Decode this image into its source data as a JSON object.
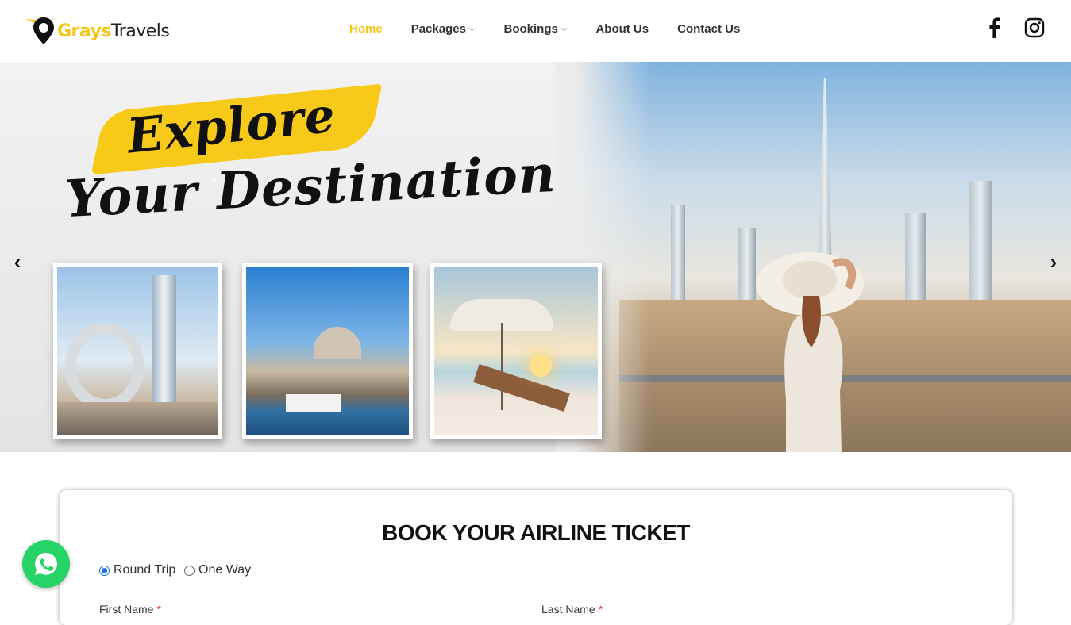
{
  "brand": {
    "part1": "Grays",
    "part2": "Travels",
    "accent_color": "#f5c518"
  },
  "nav": {
    "items": [
      {
        "label": "Home",
        "active": true,
        "dropdown": false
      },
      {
        "label": "Packages",
        "active": false,
        "dropdown": true
      },
      {
        "label": "Bookings",
        "active": false,
        "dropdown": true
      },
      {
        "label": "About Us",
        "active": false,
        "dropdown": false
      },
      {
        "label": "Contact Us",
        "active": false,
        "dropdown": false
      }
    ],
    "chevron": "⌵"
  },
  "social": {
    "icons": [
      "facebook-icon",
      "instagram-icon"
    ]
  },
  "hero": {
    "headline_line1": "Explore",
    "headline_line2": "Your Destination",
    "prev_arrow": "‹",
    "next_arrow": "›",
    "cards": [
      "museum-of-the-future-dubai",
      "istanbul-mosque-bosphorus",
      "beach-loungers-umbrella"
    ]
  },
  "booking": {
    "title": "BOOK YOUR AIRLINE TICKET",
    "trip_options": [
      {
        "label": "Round Trip",
        "selected": true
      },
      {
        "label": "One Way",
        "selected": false
      }
    ],
    "first_name_label": "First Name",
    "last_name_label": "Last Name",
    "required_mark": "*"
  },
  "whatsapp": {
    "icon": "whatsapp-icon",
    "color": "#25d366"
  }
}
